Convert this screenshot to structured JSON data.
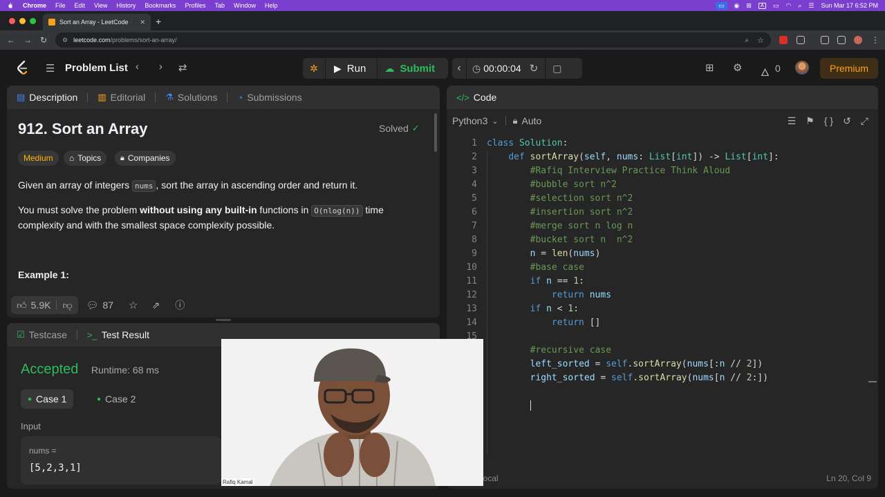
{
  "menubar": {
    "app": "Chrome",
    "items": [
      "File",
      "Edit",
      "View",
      "History",
      "Bookmarks",
      "Profiles",
      "Tab",
      "Window",
      "Help"
    ],
    "input_label": "A",
    "datetime": "Sun Mar 17  6:52 PM"
  },
  "browser": {
    "tab_title": "Sort an Array - LeetCode",
    "new_tab": "+",
    "url_host": "leetcode.com",
    "url_path": "/problems/sort-an-array/"
  },
  "nav": {
    "problem_list": "Problem List",
    "run": "Run",
    "submit": "Submit",
    "timer": "00:00:04",
    "streak": "0",
    "premium": "Premium"
  },
  "description": {
    "tabs": [
      {
        "label": "Description"
      },
      {
        "label": "Editorial"
      },
      {
        "label": "Solutions"
      },
      {
        "label": "Submissions"
      }
    ],
    "title": "912. Sort an Array",
    "solved": "Solved",
    "difficulty": "Medium",
    "topics": "Topics",
    "companies": "Companies",
    "p1_a": "Given an array of integers ",
    "p1_code": "nums",
    "p1_b": ", sort the array in ascending order and return it.",
    "p2_a": "You must solve the problem ",
    "p2_bold": "without using any built-in",
    "p2_b": " functions in ",
    "p2_code": "O(nlog(n))",
    "p2_c": " time complexity and with the smallest space complexity possible.",
    "example": "Example 1:",
    "likes": "5.9K",
    "comments": "87"
  },
  "test": {
    "tab_testcase": "Testcase",
    "tab_result": "Test Result",
    "status": "Accepted",
    "runtime": "Runtime: 68 ms",
    "case1": "Case 1",
    "case2": "Case 2",
    "input_label": "Input",
    "nums_label": "nums =",
    "nums_value": "[5,2,3,1]"
  },
  "code": {
    "header": "Code",
    "language": "Python3",
    "auto": "Auto",
    "footer_left": "o local",
    "footer_right": "Ln 20, Col 9"
  },
  "webcam": {
    "name": "Rafiq Kamal"
  },
  "colors": {
    "accent_green": "#2cbb5d",
    "premium_orange": "#ffa116",
    "menubar_purple": "#7b3fd0",
    "medium_yellow": "#ffb800"
  }
}
